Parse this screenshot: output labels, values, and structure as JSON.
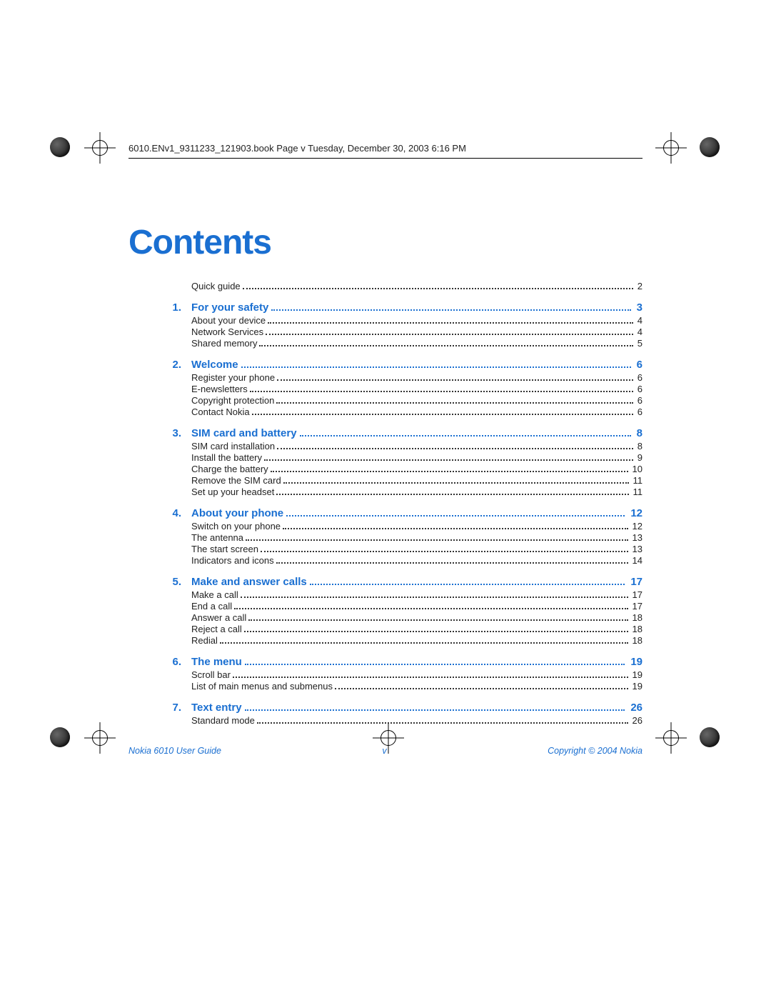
{
  "header": "6010.ENv1_9311233_121903.book  Page v  Tuesday, December 30, 2003  6:16 PM",
  "title": "Contents",
  "pre_items": [
    {
      "title": "Quick guide",
      "page": "2"
    }
  ],
  "chapters": [
    {
      "num": "1.",
      "title": "For your safety",
      "page": "3",
      "items": [
        {
          "title": "About your device",
          "page": "4"
        },
        {
          "title": "Network Services",
          "page": "4"
        },
        {
          "title": "Shared memory",
          "page": "5"
        }
      ]
    },
    {
      "num": "2.",
      "title": "Welcome",
      "page": "6",
      "items": [
        {
          "title": "Register your phone",
          "page": "6"
        },
        {
          "title": "E-newsletters",
          "page": "6"
        },
        {
          "title": "Copyright protection",
          "page": "6"
        },
        {
          "title": "Contact Nokia",
          "page": "6"
        }
      ]
    },
    {
      "num": "3.",
      "title": "SIM card and battery",
      "page": "8",
      "items": [
        {
          "title": "SIM card installation",
          "page": "8"
        },
        {
          "title": "Install the battery",
          "page": "9"
        },
        {
          "title": "Charge the battery",
          "page": "10"
        },
        {
          "title": "Remove the SIM card",
          "page": "11"
        },
        {
          "title": "Set up your headset",
          "page": "11"
        }
      ]
    },
    {
      "num": "4.",
      "title": "About your phone",
      "page": "12",
      "items": [
        {
          "title": "Switch on your phone",
          "page": "12"
        },
        {
          "title": "The antenna",
          "page": "13"
        },
        {
          "title": "The start screen",
          "page": "13"
        },
        {
          "title": "Indicators and icons",
          "page": "14"
        }
      ]
    },
    {
      "num": "5.",
      "title": "Make and answer calls",
      "page": "17",
      "items": [
        {
          "title": "Make a call",
          "page": "17"
        },
        {
          "title": "End a call",
          "page": "17"
        },
        {
          "title": "Answer a call",
          "page": "18"
        },
        {
          "title": "Reject a call",
          "page": "18"
        },
        {
          "title": "Redial",
          "page": "18"
        }
      ]
    },
    {
      "num": "6.",
      "title": "The menu",
      "page": "19",
      "items": [
        {
          "title": "Scroll bar",
          "page": "19"
        },
        {
          "title": "List of main menus and submenus",
          "page": "19"
        }
      ]
    },
    {
      "num": "7.",
      "title": "Text entry",
      "page": "26",
      "items": [
        {
          "title": "Standard mode",
          "page": "26"
        }
      ]
    }
  ],
  "footer": {
    "left": "Nokia 6010 User Guide",
    "center": "v",
    "right": "Copyright © 2004 Nokia"
  }
}
